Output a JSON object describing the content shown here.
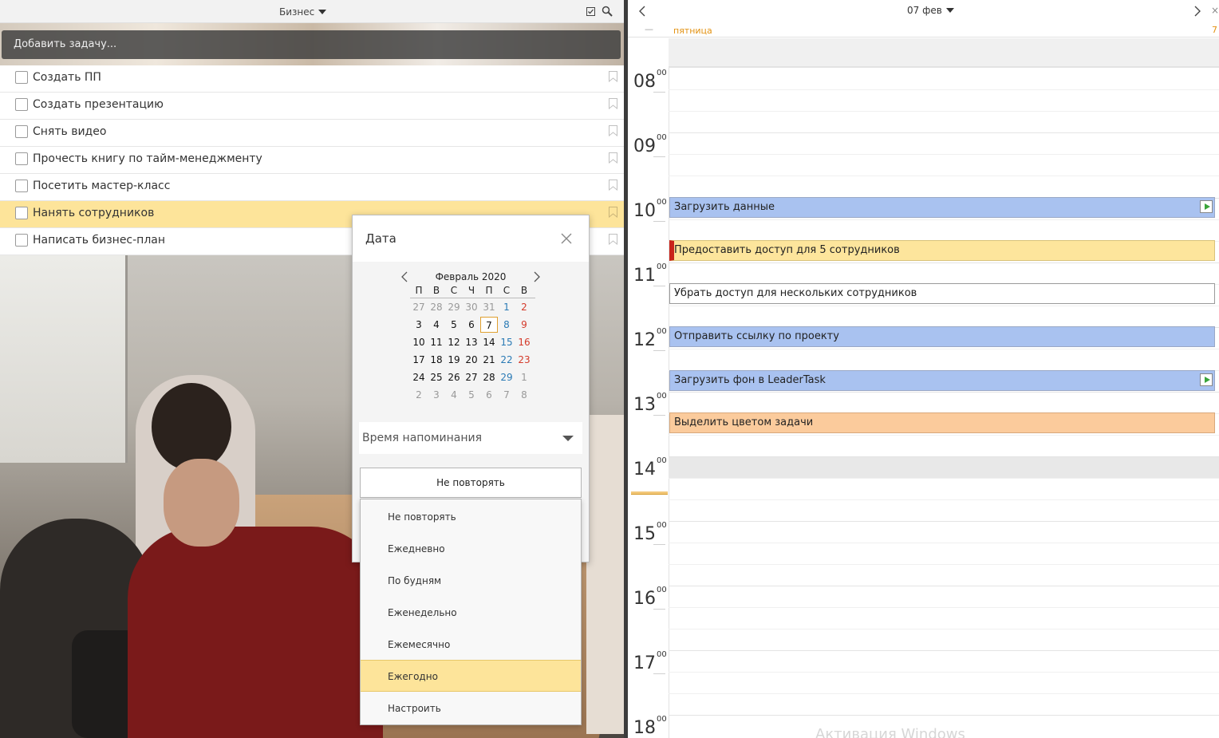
{
  "left": {
    "project": "Бизнес",
    "add_placeholder": "Добавить задачу...",
    "tasks": [
      {
        "title": "Создать ПП"
      },
      {
        "title": "Создать презентацию"
      },
      {
        "title": "Снять видео"
      },
      {
        "title": "Прочесть книгу по тайм-менеджменту"
      },
      {
        "title": "Посетить мастер-класс"
      },
      {
        "title": "Нанять сотрудников",
        "selected": true
      },
      {
        "title": "Написать бизнес-план"
      }
    ]
  },
  "date_popup": {
    "title": "Дата",
    "month": "Февраль 2020",
    "weekdays": [
      "П",
      "В",
      "С",
      "Ч",
      "П",
      "С",
      "В"
    ],
    "weeks": [
      [
        "27",
        "28",
        "29",
        "30",
        "31",
        "1",
        "2"
      ],
      [
        "3",
        "4",
        "5",
        "6",
        "7",
        "8",
        "9"
      ],
      [
        "10",
        "11",
        "12",
        "13",
        "14",
        "15",
        "16"
      ],
      [
        "17",
        "18",
        "19",
        "20",
        "21",
        "22",
        "23"
      ],
      [
        "24",
        "25",
        "26",
        "27",
        "28",
        "29",
        "1"
      ],
      [
        "2",
        "3",
        "4",
        "5",
        "6",
        "7",
        "8"
      ]
    ],
    "selected_day": "7",
    "reminder_label": "Время напоминания",
    "repeat_value": "Не повторять",
    "repeat_options": [
      "Не повторять",
      "Ежедневно",
      "По будням",
      "Еженедельно",
      "Ежемесячно",
      "Ежегодно",
      "Настроить"
    ],
    "repeat_active": "Ежегодно"
  },
  "calendar": {
    "date_label": "07 фев",
    "day_name": "пятница",
    "day_number": "7",
    "hours": [
      "08",
      "09",
      "10",
      "11",
      "12",
      "13",
      "14",
      "15",
      "16",
      "17",
      "18"
    ],
    "minutes": "00",
    "events": [
      {
        "title": "Загрузить данные",
        "style": "blue",
        "play": true
      },
      {
        "title": "Предоставить доступ для 5 сотрудников",
        "style": "yellow",
        "play": false
      },
      {
        "title": "Убрать доступ для нескольких сотрудников",
        "style": "white",
        "play": false
      },
      {
        "title": "Отправить ссылку по проекту",
        "style": "blue",
        "play": false
      },
      {
        "title": "Загрузить фон в LeaderTask",
        "style": "blue",
        "play": true
      },
      {
        "title": "Выделить цветом задачи",
        "style": "orange",
        "play": false
      }
    ],
    "watermark": "Активация Windows"
  },
  "colors": {
    "selection": "#fde49a",
    "accent_orange": "#e39212",
    "event_blue": "#a9c2f0",
    "event_orange": "#fbcb9c",
    "saturday": "#2a7ab5",
    "sunday": "#d43a2a"
  },
  "icons": {
    "checklist": "check-square-icon",
    "search": "search-icon",
    "bookmark": "bookmark-icon",
    "close": "close-icon",
    "prev": "chevron-left-icon",
    "next": "chevron-right-icon",
    "play": "play-icon"
  }
}
